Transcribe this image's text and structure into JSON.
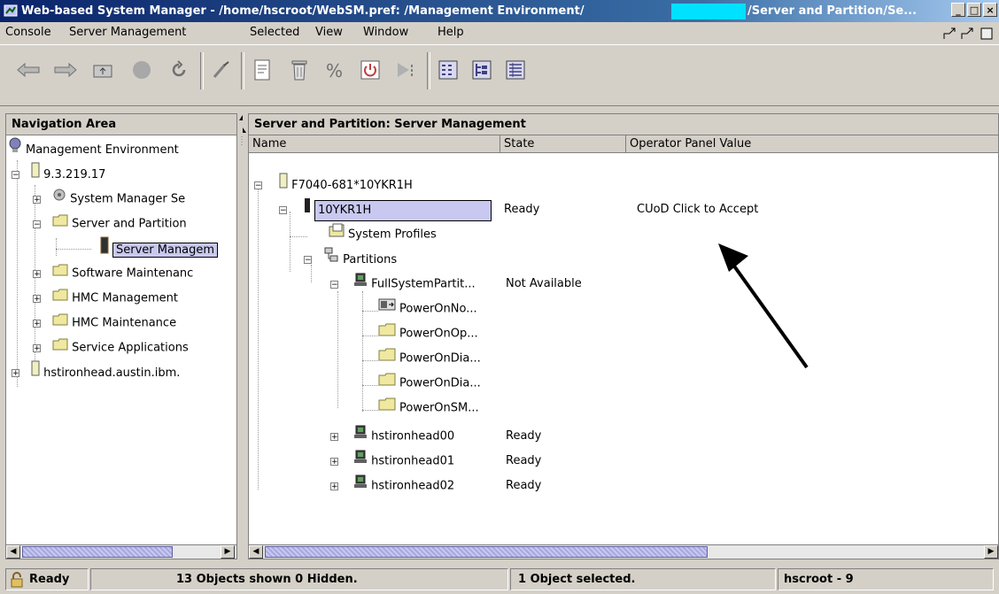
{
  "window": {
    "title_left": "Web-based System Manager - /home/hscroot/WebSM.pref: /Management Environment/",
    "title_right": "/Server and Partition/Se..."
  },
  "menu": [
    "Console",
    "Server Management",
    "Selected",
    "View",
    "Window",
    "Help"
  ],
  "toolbar": {
    "buttons": [
      "back-icon",
      "forward-icon",
      "up-folder-icon",
      "stop-icon",
      "refresh-icon",
      "find-icon",
      "properties-icon",
      "delete-icon",
      "percent-icon",
      "power-icon",
      "activate-icon",
      "view-small-icon",
      "view-tree-icon",
      "view-details-icon"
    ]
  },
  "nav": {
    "header": "Navigation Area",
    "items": [
      {
        "label": "Management Environment"
      },
      {
        "label": "9.3.219.17"
      },
      {
        "label": "System Manager Se"
      },
      {
        "label": "Server and Partition"
      },
      {
        "label": "Server Managem"
      },
      {
        "label": "Software Maintenanc"
      },
      {
        "label": "HMC Management"
      },
      {
        "label": "HMC Maintenance"
      },
      {
        "label": "Service Applications"
      },
      {
        "label": "hstironhead.austin.ibm."
      }
    ]
  },
  "main": {
    "header": "Server and Partition: Server Management",
    "columns": [
      "Name",
      "State",
      "Operator Panel Value"
    ],
    "rows": [
      {
        "name": "F7040-681*10YKR1H",
        "state": "",
        "panel": ""
      },
      {
        "name": "10YKR1H",
        "state": "Ready",
        "panel": "CUoD Click to Accept"
      },
      {
        "name": "System Profiles",
        "state": "",
        "panel": ""
      },
      {
        "name": "Partitions",
        "state": "",
        "panel": ""
      },
      {
        "name": "FullSystemPartit...",
        "state": "Not Available",
        "panel": ""
      },
      {
        "name": "PowerOnNo...",
        "state": "",
        "panel": ""
      },
      {
        "name": "PowerOnOp...",
        "state": "",
        "panel": ""
      },
      {
        "name": "PowerOnDia...",
        "state": "",
        "panel": ""
      },
      {
        "name": "PowerOnDia...",
        "state": "",
        "panel": ""
      },
      {
        "name": "PowerOnSM...",
        "state": "",
        "panel": ""
      },
      {
        "name": "hstironhead00",
        "state": "Ready",
        "panel": ""
      },
      {
        "name": "hstironhead01",
        "state": "Ready",
        "panel": ""
      },
      {
        "name": "hstironhead02",
        "state": "Ready",
        "panel": ""
      }
    ]
  },
  "status": {
    "ready": "Ready",
    "shown": "13 Objects shown 0 Hidden.",
    "selected": "1 Object selected.",
    "user": "hscroot - 9"
  },
  "colors": {
    "selection": "#c8c8f0",
    "titlebar": "#0a246a",
    "redaction": "#00e0ff"
  }
}
